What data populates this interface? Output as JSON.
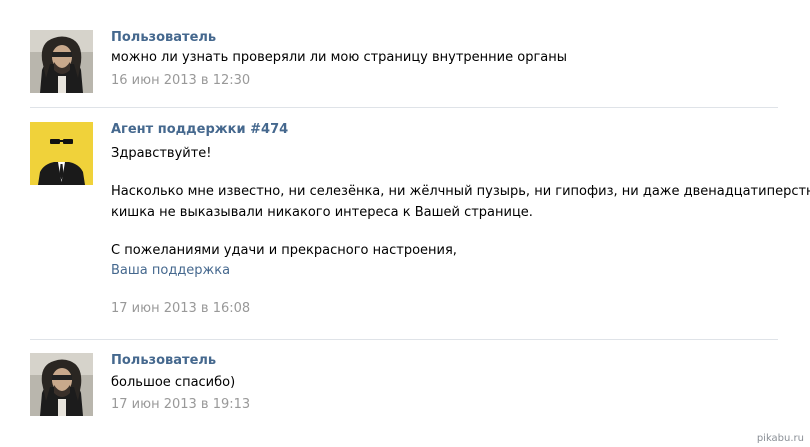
{
  "messages": [
    {
      "author": "Пользователь",
      "avatar_icon": "user-photo-avatar",
      "lines": [
        "можно ли узнать проверяли ли мою страницу внутренние органы"
      ],
      "date": "16 июн 2013 в 12:30"
    },
    {
      "author": "Агент поддержки #474",
      "avatar_icon": "support-agent-avatar",
      "greeting": "Здравствуйте!",
      "body_line1": "Насколько мне известно, ни селезёнка, ни жёлчный пузырь, ни гипофиз, ни даже двенадцатиперстная",
      "body_line2": "кишка не выказывали никакого интереса к Вашей странице.",
      "closing": "С пожеланиями удачи и прекрасного настроения,",
      "signature": "Ваша поддержка",
      "date": "17 июн 2013 в 16:08"
    },
    {
      "author": "Пользователь",
      "avatar_icon": "user-photo-avatar",
      "lines": [
        "большое спасибо)"
      ],
      "date": "17 июн 2013 в 19:13"
    }
  ],
  "watermark": "pikabu.ru",
  "colors": {
    "link": "#45688e",
    "date": "#999999",
    "divider": "#dfe3e8",
    "agent_avatar_bg": "#f0d23a"
  }
}
